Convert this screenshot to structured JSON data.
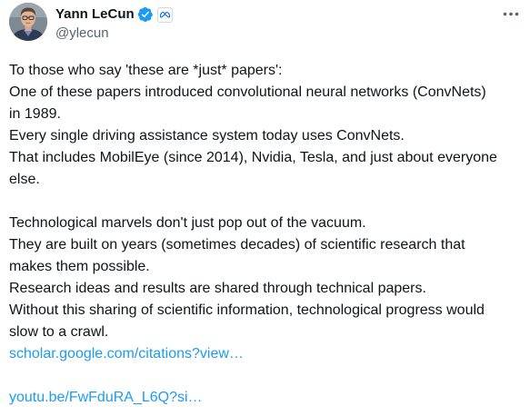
{
  "author": {
    "name": "Yann LeCun",
    "handle": "@ylecun",
    "verified": true,
    "affiliation_badge": "meta-icon"
  },
  "colors": {
    "text": "#0f1419",
    "secondary": "#536471",
    "link": "#1d9bf0",
    "verified": "#1d9bf0"
  },
  "tweet": {
    "lines": [
      "To those who say 'these are *just* papers':",
      "One of these papers introduced convolutional neural networks (ConvNets)",
      "in 1989.",
      "Every single driving assistance system today uses ConvNets.",
      "That includes MobilEye (since 2014), Nvidia, Tesla, and just about everyone",
      "else.",
      "",
      "Technological marvels don't just pop out of the vacuum.",
      "They are built on years (sometimes decades) of scientific research that",
      "makes them possible.",
      "Research ideas and results are shared through technical papers.",
      "Without this sharing of scientific information, technological progress would",
      "slow to a crawl."
    ],
    "link1": "scholar.google.com/citations?view…",
    "link2": "youtu.be/FwFduRA_L6Q?si…"
  },
  "icons": {
    "more": "more-options-icon",
    "verified": "verified-badge-icon"
  }
}
